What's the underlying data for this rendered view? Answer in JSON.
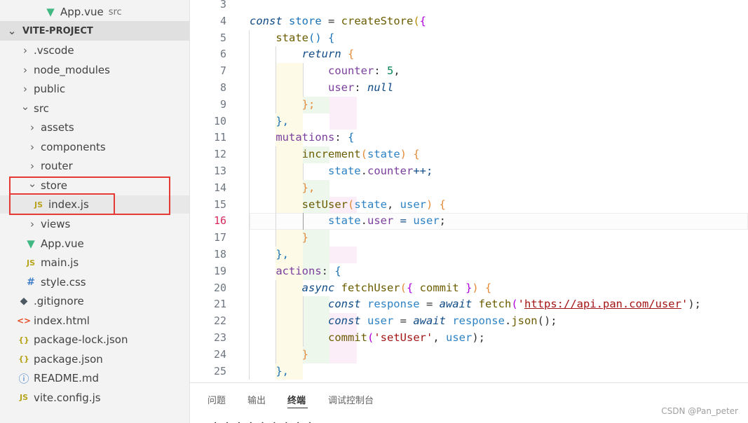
{
  "sidebar": {
    "open_editor": {
      "name": "App.vue",
      "desc": "src"
    },
    "project": "VITE-PROJECT",
    "items": [
      {
        "label": ".vscode",
        "kind": "folder",
        "expanded": false,
        "depth": 1
      },
      {
        "label": "node_modules",
        "kind": "folder",
        "expanded": false,
        "depth": 1
      },
      {
        "label": "public",
        "kind": "folder",
        "expanded": false,
        "depth": 1
      },
      {
        "label": "src",
        "kind": "folder",
        "expanded": true,
        "depth": 1
      },
      {
        "label": "assets",
        "kind": "folder",
        "expanded": false,
        "depth": 2
      },
      {
        "label": "components",
        "kind": "folder",
        "expanded": false,
        "depth": 2
      },
      {
        "label": "router",
        "kind": "folder",
        "expanded": false,
        "depth": 2
      },
      {
        "label": "store",
        "kind": "folder",
        "expanded": true,
        "depth": 2
      },
      {
        "label": "index.js",
        "kind": "file",
        "icon": "js-file-icon",
        "glyph": "JS",
        "depth": 3,
        "selected": true
      },
      {
        "label": "views",
        "kind": "folder",
        "expanded": false,
        "depth": 2
      },
      {
        "label": "App.vue",
        "kind": "file",
        "icon": "vue-file-icon",
        "glyph": "▼",
        "depth": 2
      },
      {
        "label": "main.js",
        "kind": "file",
        "icon": "js-file-icon",
        "glyph": "JS",
        "depth": 2
      },
      {
        "label": "style.css",
        "kind": "file",
        "icon": "css-file-icon",
        "glyph": "#",
        "depth": 2
      },
      {
        "label": ".gitignore",
        "kind": "file",
        "icon": "git-file-icon",
        "glyph": "◆",
        "depth": 1
      },
      {
        "label": "index.html",
        "kind": "file",
        "icon": "html-file-icon",
        "glyph": "<>",
        "depth": 1
      },
      {
        "label": "package-lock.json",
        "kind": "file",
        "icon": "json-file-icon",
        "glyph": "{}",
        "depth": 1
      },
      {
        "label": "package.json",
        "kind": "file",
        "icon": "json-file-icon",
        "glyph": "{}",
        "depth": 1
      },
      {
        "label": "README.md",
        "kind": "file",
        "icon": "info-file-icon",
        "glyph": "ⓘ",
        "depth": 1
      },
      {
        "label": "vite.config.js",
        "kind": "file",
        "icon": "js-file-icon",
        "glyph": "JS",
        "depth": 1
      }
    ]
  },
  "editor": {
    "first_line": 3,
    "current_line": 16,
    "lines": [
      [],
      [
        [
          "const ",
          "kw"
        ],
        [
          "store",
          "cn"
        ],
        [
          " = ",
          ""
        ],
        [
          "createStore",
          "fn"
        ],
        [
          "(",
          "pr1"
        ],
        [
          "{",
          "pr2"
        ]
      ],
      [
        [
          "    ",
          ""
        ],
        [
          "state",
          "fn"
        ],
        [
          "() ",
          "pr3"
        ],
        [
          "{",
          "pr3"
        ]
      ],
      [
        [
          "        ",
          ""
        ],
        [
          "return ",
          "kw"
        ],
        [
          "{",
          "pp"
        ]
      ],
      [
        [
          "            ",
          ""
        ],
        [
          "counter",
          "prop"
        ],
        [
          ": ",
          ""
        ],
        [
          "5",
          "num"
        ],
        [
          ",",
          ""
        ]
      ],
      [
        [
          "            ",
          ""
        ],
        [
          "user",
          "prop"
        ],
        [
          ": ",
          ""
        ],
        [
          "null",
          "nul"
        ]
      ],
      [
        [
          "        ",
          ""
        ],
        [
          "};",
          "pp"
        ]
      ],
      [
        [
          "    ",
          ""
        ],
        [
          "},",
          "pr3"
        ]
      ],
      [
        [
          "    ",
          ""
        ],
        [
          "mutations",
          "prop"
        ],
        [
          ": ",
          ""
        ],
        [
          "{",
          "pr3"
        ]
      ],
      [
        [
          "        ",
          ""
        ],
        [
          "increment",
          "fn"
        ],
        [
          "(",
          "pp"
        ],
        [
          "state",
          "var"
        ],
        [
          ") ",
          "pp"
        ],
        [
          "{",
          "pp"
        ]
      ],
      [
        [
          "            ",
          ""
        ],
        [
          "state",
          "var"
        ],
        [
          ".",
          ""
        ],
        [
          "counter",
          "prop"
        ],
        [
          "++;",
          "op"
        ]
      ],
      [
        [
          "        ",
          ""
        ],
        [
          "},",
          "pp"
        ]
      ],
      [
        [
          "        ",
          ""
        ],
        [
          "setUser",
          "fn"
        ],
        [
          "(",
          "pp"
        ],
        [
          "state",
          "var"
        ],
        [
          ", ",
          ""
        ],
        [
          "user",
          "var"
        ],
        [
          ") ",
          "pp"
        ],
        [
          "{",
          "pp"
        ]
      ],
      [
        [
          "            ",
          ""
        ],
        [
          "state",
          "var"
        ],
        [
          ".",
          ""
        ],
        [
          "user",
          "prop"
        ],
        [
          " = ",
          "op"
        ],
        [
          "user",
          "var"
        ],
        [
          ";",
          ""
        ]
      ],
      [
        [
          "        ",
          ""
        ],
        [
          "}",
          "pp"
        ]
      ],
      [
        [
          "    ",
          ""
        ],
        [
          "},",
          "pr3"
        ]
      ],
      [
        [
          "    ",
          ""
        ],
        [
          "actions",
          "prop"
        ],
        [
          ": ",
          ""
        ],
        [
          "{",
          "pr3"
        ]
      ],
      [
        [
          "        ",
          ""
        ],
        [
          "async ",
          "kw"
        ],
        [
          "fetchUser",
          "fn"
        ],
        [
          "(",
          "pp"
        ],
        [
          "{ ",
          "pr2"
        ],
        [
          "commit",
          "fn"
        ],
        [
          " }",
          "pr2"
        ],
        [
          ") ",
          "pp"
        ],
        [
          "{",
          "pp"
        ]
      ],
      [
        [
          "            ",
          ""
        ],
        [
          "const ",
          "kw"
        ],
        [
          "response",
          "var"
        ],
        [
          " = ",
          ""
        ],
        [
          "await ",
          "kw"
        ],
        [
          "fetch",
          "fn"
        ],
        [
          "(",
          "pr2"
        ],
        [
          "'",
          "str"
        ],
        [
          "https://api.pan.com/user",
          "url"
        ],
        [
          "'",
          "str"
        ],
        [
          ");",
          ""
        ]
      ],
      [
        [
          "            ",
          ""
        ],
        [
          "const ",
          "kw"
        ],
        [
          "user",
          "var"
        ],
        [
          " = ",
          ""
        ],
        [
          "await ",
          "kw"
        ],
        [
          "response",
          "var"
        ],
        [
          ".",
          ""
        ],
        [
          "json",
          "fn"
        ],
        [
          "();",
          ""
        ]
      ],
      [
        [
          "            ",
          ""
        ],
        [
          "commit",
          "fn"
        ],
        [
          "(",
          "pr2"
        ],
        [
          "'setUser'",
          "str"
        ],
        [
          ", ",
          ""
        ],
        [
          "user",
          "var"
        ],
        [
          ");",
          ""
        ]
      ],
      [
        [
          "        ",
          ""
        ],
        [
          "}",
          "pp"
        ]
      ],
      [
        [
          "    ",
          ""
        ],
        [
          "},",
          "pr3"
        ]
      ]
    ]
  },
  "panel": {
    "tabs": [
      "问题",
      "输出",
      "终端",
      "调试控制台"
    ],
    "active_tab": 2,
    "terminal_partial": "· ·  ·   ·  ·  ·  ·   · ·"
  },
  "watermark": "CSDN @Pan_peter"
}
